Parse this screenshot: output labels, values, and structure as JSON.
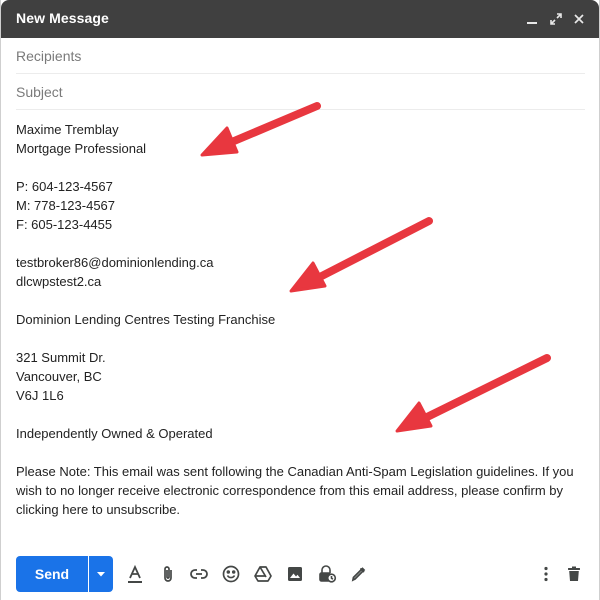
{
  "window": {
    "title": "New Message"
  },
  "fields": {
    "recipients_placeholder": "Recipients",
    "subject_placeholder": "Subject"
  },
  "signature": {
    "name": "Maxime Tremblay",
    "role": "Mortgage Professional",
    "phone": "P: 604-123-4567",
    "mobile": "M: 778-123-4567",
    "fax": "F: 605-123-4455",
    "email": "testbroker86@dominionlending.ca",
    "website": "dlcwpstest2.ca",
    "company": "Dominion Lending Centres Testing Franchise",
    "address_line1": "321 Summit Dr.",
    "address_line2": "Vancouver, BC",
    "address_line3": "V6J 1L6",
    "ownership": "Independently Owned & Operated",
    "notice_line1": "Please Note: This email was sent following the Canadian Anti-Spam Legislation guidelines. If you",
    "notice_line2": "wish to no longer receive electronic correspondence from this email address, please confirm by",
    "notice_line3": "clicking here to unsubscribe."
  },
  "toolbar": {
    "send_label": "Send",
    "icons": [
      "send-options-icon",
      "formatting-icon",
      "attach-icon",
      "link-icon",
      "emoji-icon",
      "drive-icon",
      "photo-icon",
      "confidential-mode-icon",
      "signature-icon",
      "more-options-icon",
      "trash-icon"
    ]
  },
  "colors": {
    "titlebar": "#404040",
    "send_button": "#1a73e8",
    "arrow": "#e8373f",
    "icon": "#444746"
  }
}
